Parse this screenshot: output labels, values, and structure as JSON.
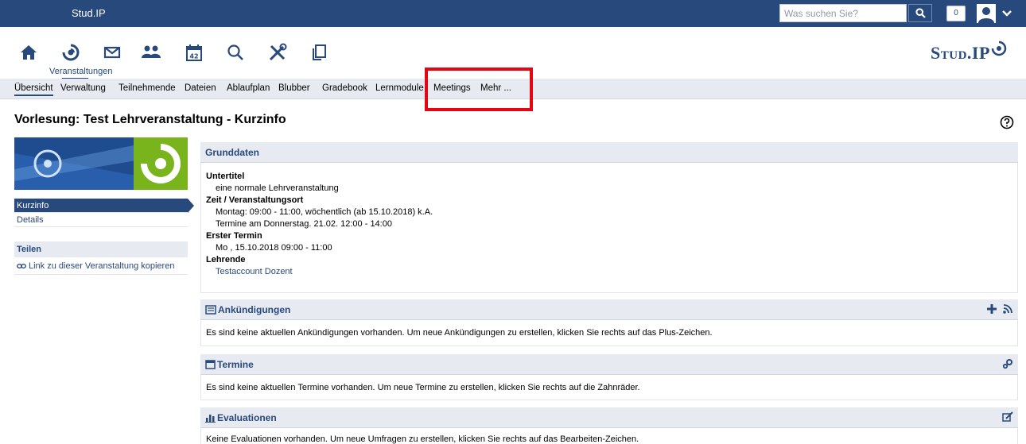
{
  "topbar": {
    "site_title": "Stud.IP",
    "search_placeholder": "Was suchen Sie?",
    "notification_count": "0"
  },
  "header": {
    "active_nav_label": "Veranstaltungen",
    "calendar_day": "42",
    "logo_text": "Stud.IP"
  },
  "tabs": [
    {
      "label": "Übersicht"
    },
    {
      "label": "Verwaltung"
    },
    {
      "label": "Teilnehmende"
    },
    {
      "label": "Dateien"
    },
    {
      "label": "Ablaufplan"
    },
    {
      "label": "Blubber"
    },
    {
      "label": "Gradebook"
    },
    {
      "label": "Lernmodule"
    },
    {
      "label": "Meetings"
    },
    {
      "label": "Mehr ..."
    }
  ],
  "page": {
    "title": "Vorlesung: Test Lehrveranstaltung - Kurzinfo"
  },
  "sidebar": {
    "items": [
      {
        "label": "Kurzinfo"
      },
      {
        "label": "Details"
      }
    ],
    "share": {
      "title": "Teilen",
      "link_label": "Link zu dieser Veranstaltung kopieren"
    }
  },
  "grunddaten": {
    "title": "Grunddaten",
    "untertitel_label": "Untertitel",
    "untertitel_value": "eine normale Lehrveranstaltung",
    "zeit_label": "Zeit / Veranstaltungsort",
    "zeit_value_1": "Montag: 09:00 - 11:00, wöchentlich (ab 15.10.2018) k.A.",
    "zeit_value_2": "Termine am Donnerstag. 21.02. 12:00 - 14:00",
    "erster_label": "Erster Termin",
    "erster_value": "Mo , 15.10.2018 09:00 - 11:00",
    "lehrende_label": "Lehrende",
    "lehrende_value": "Testaccount Dozent"
  },
  "ankuendigungen": {
    "title": "Ankündigungen",
    "text": "Es sind keine aktuellen Ankündigungen vorhanden. Um neue Ankündigungen zu erstellen, klicken Sie rechts auf das Plus-Zeichen."
  },
  "termine": {
    "title": "Termine",
    "text": "Es sind keine aktuellen Termine vorhanden. Um neue Termine zu erstellen, klicken Sie rechts auf die Zahnräder."
  },
  "evaluationen": {
    "title": "Evaluationen",
    "text": "Keine Evaluationen vorhanden. Um neue Umfragen zu erstellen, klicken Sie rechts auf das Bearbeiten-Zeichen."
  },
  "colors": {
    "brand": "#28497c",
    "highlight": "#e30613",
    "panel": "#e7ebf1"
  }
}
